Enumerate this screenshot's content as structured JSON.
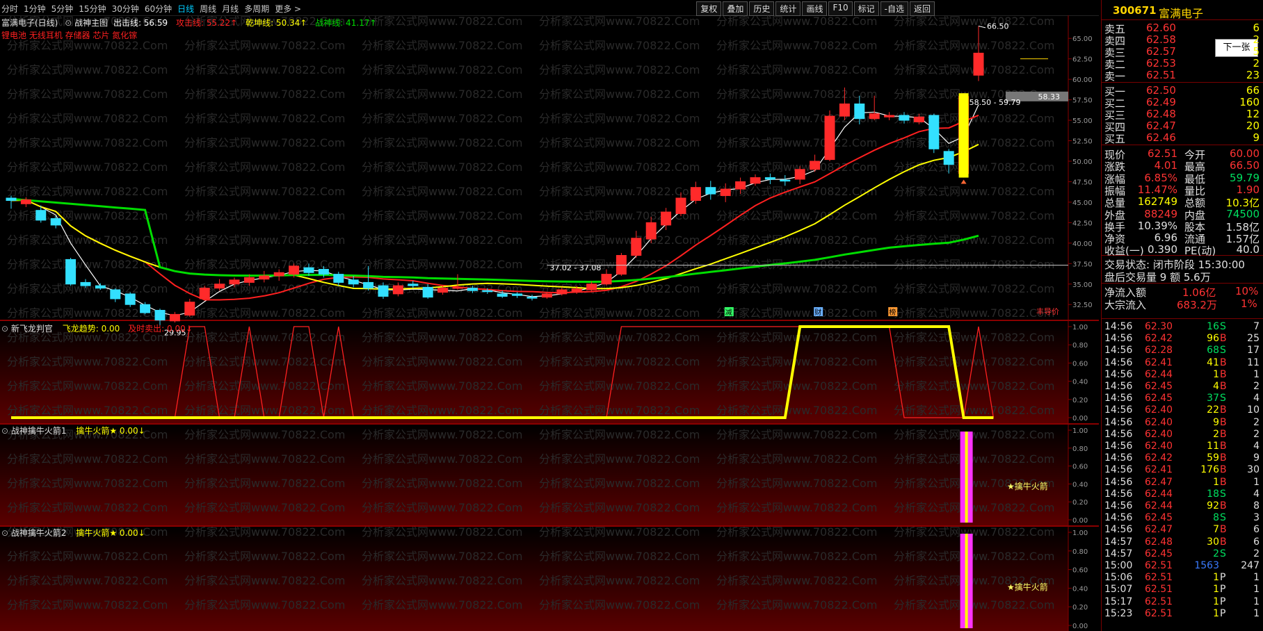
{
  "periods": [
    "分时",
    "1分钟",
    "5分钟",
    "15分钟",
    "30分钟",
    "60分钟",
    "日线",
    "周线",
    "月线",
    "多周期",
    "更多 >"
  ],
  "active_period": "日线",
  "toolbar": [
    "复权",
    "叠加",
    "历史",
    "统计",
    "画线",
    "F10",
    "标记",
    "-自选",
    "返回"
  ],
  "main_legend": {
    "stock": "富满电子(日线)",
    "indicator": "战神主图",
    "out_line": "出击线: 56.59",
    "attack_line": "攻击线: 55.22↑",
    "qian_line": "乾坤线: 50.34↑",
    "zhan_line": "战神线: 41.17↑"
  },
  "concepts": "锂电池 无线耳机 存储器 芯片 氮化镓",
  "price_labels": {
    "high": "66.50",
    "low": "29.95",
    "range1": "58.50 - 59.79",
    "range2": "37.02 - 37.08",
    "current": "58.33"
  },
  "markers": {
    "m1": "减",
    "m2": "财",
    "m3": "榜",
    "m4": "丰导价"
  },
  "y_axis_main": [
    "65.00",
    "62.50",
    "60.00",
    "57.50",
    "55.00",
    "52.50",
    "50.00",
    "47.50",
    "45.00",
    "42.50",
    "40.00",
    "37.50",
    "35.00",
    "32.50"
  ],
  "y_axis_ind": [
    "1.00",
    "0.80",
    "0.60",
    "0.40",
    "0.20",
    "0.00"
  ],
  "panel2": {
    "title": "新飞龙判官",
    "l1": "飞龙趋势: 0.00",
    "l2": "及时卖出: 0.00↓"
  },
  "panel3": {
    "title": "战神擒牛火箭1",
    "l1": "擒牛火箭★ 0.00↓",
    "flag": "★擒牛火箭"
  },
  "panel4": {
    "title": "战神擒牛火箭2",
    "l1": "擒牛火箭★ 0.00↓",
    "flag": "★擒牛火箭"
  },
  "watermark": "分析家公式网www.70822.Com",
  "chart_data": {
    "type": "candlestick",
    "candles": [
      [
        45.5,
        45.2,
        45.8,
        44.2
      ],
      [
        44.8,
        45.3,
        45.6,
        44.4
      ],
      [
        44.0,
        42.8,
        44.6,
        42.5
      ],
      [
        43.0,
        42.2,
        43.3,
        41.8
      ],
      [
        38.0,
        35.0,
        38.2,
        34.8
      ],
      [
        35.2,
        34.8,
        35.6,
        34.5
      ],
      [
        34.8,
        34.5,
        35.1,
        34.3
      ],
      [
        34.3,
        33.2,
        34.5,
        32.8
      ],
      [
        33.8,
        32.5,
        34.0,
        32.2
      ],
      [
        32.5,
        31.5,
        32.8,
        31.3
      ],
      [
        31.8,
        30.6,
        32.0,
        29.95
      ],
      [
        30.5,
        31.3,
        31.6,
        30.3
      ],
      [
        31.2,
        32.8,
        33.2,
        31.0
      ],
      [
        33.2,
        34.5,
        34.8,
        33.0
      ],
      [
        34.5,
        35.0,
        35.6,
        34.2
      ],
      [
        35.0,
        35.5,
        35.8,
        34.6
      ],
      [
        35.2,
        35.8,
        36.2,
        34.8
      ],
      [
        35.6,
        36.0,
        36.6,
        35.2
      ],
      [
        36.0,
        36.4,
        36.8,
        35.4
      ],
      [
        36.2,
        37.2,
        37.5,
        35.8
      ],
      [
        37.0,
        36.4,
        37.5,
        36.0
      ],
      [
        36.8,
        36.2,
        37.2,
        35.8
      ],
      [
        36.2,
        35.2,
        36.5,
        34.8
      ],
      [
        35.5,
        35.0,
        36.0,
        34.6
      ],
      [
        35.2,
        34.5,
        37.2,
        34.2
      ],
      [
        34.8,
        33.5,
        35.2,
        33.2
      ],
      [
        33.8,
        34.8,
        35.2,
        33.5
      ],
      [
        35.0,
        34.8,
        35.4,
        34.5
      ],
      [
        34.6,
        33.4,
        35.0,
        33.2
      ],
      [
        34.0,
        34.5,
        34.8,
        33.7
      ],
      [
        34.5,
        34.6,
        36.2,
        34.3
      ],
      [
        34.5,
        34.2,
        34.8,
        33.9
      ],
      [
        34.2,
        34.1,
        34.5,
        33.8
      ],
      [
        33.8,
        33.5,
        34.2,
        33.3
      ],
      [
        33.8,
        33.6,
        34.0,
        33.3
      ],
      [
        33.4,
        33.3,
        33.7,
        33.0
      ],
      [
        33.4,
        33.8,
        34.0,
        33.2
      ],
      [
        33.8,
        34.3,
        34.6,
        33.6
      ],
      [
        34.0,
        34.4,
        34.8,
        33.8
      ],
      [
        34.3,
        35.0,
        35.3,
        34.0
      ],
      [
        35.0,
        36.2,
        36.8,
        34.8
      ],
      [
        36.2,
        38.5,
        38.8,
        36.0
      ],
      [
        38.5,
        40.6,
        41.5,
        38.2
      ],
      [
        40.5,
        42.5,
        43.2,
        40.0
      ],
      [
        42.2,
        43.8,
        44.3,
        41.6
      ],
      [
        43.6,
        45.5,
        46.2,
        43.3
      ],
      [
        45.2,
        46.8,
        47.5,
        44.8
      ],
      [
        46.8,
        46.0,
        47.6,
        45.3
      ],
      [
        45.8,
        46.6,
        47.3,
        45.0
      ],
      [
        46.6,
        47.5,
        48.0,
        46.0
      ],
      [
        47.3,
        48.0,
        48.4,
        47.0
      ],
      [
        48.0,
        47.8,
        48.5,
        47.2
      ],
      [
        47.7,
        47.6,
        48.3,
        47.0
      ],
      [
        47.8,
        49.0,
        49.4,
        47.2
      ],
      [
        49.0,
        50.0,
        50.8,
        48.7
      ],
      [
        50.2,
        55.5,
        56.2,
        50.0
      ],
      [
        55.5,
        57.0,
        59.0,
        55.0
      ],
      [
        57.0,
        55.2,
        58.0,
        54.5
      ],
      [
        55.2,
        55.8,
        58.0,
        55.0
      ],
      [
        55.4,
        55.6,
        56.0,
        55.0
      ],
      [
        55.6,
        55.0,
        56.0,
        54.6
      ],
      [
        54.8,
        55.4,
        55.8,
        54.5
      ],
      [
        55.6,
        51.5,
        55.8,
        51.0
      ],
      [
        51.2,
        49.6,
        51.5,
        48.5
      ],
      [
        48.5,
        57.9,
        58.3,
        48.0
      ],
      [
        60.5,
        63.2,
        66.5,
        59.79
      ]
    ],
    "ma_series": [
      {
        "name": "出击线",
        "last": 56.59,
        "color": "#ffffff"
      },
      {
        "name": "攻击线",
        "last": 55.22,
        "color": "#ff2020"
      },
      {
        "name": "乾坤线",
        "last": 50.34,
        "color": "#ffff00"
      },
      {
        "name": "战神线",
        "last": 41.17,
        "color": "#00dd00"
      }
    ],
    "ylim": [
      31.5,
      66.8
    ],
    "indicator_feilong_qushi": [
      0,
      0,
      0,
      0,
      0,
      0,
      0,
      0,
      0,
      0,
      0,
      0,
      0,
      0,
      0,
      0,
      0,
      0,
      0,
      0,
      0,
      0,
      0,
      0,
      0,
      0,
      0,
      0,
      0,
      0,
      0,
      0,
      0,
      0,
      0,
      0,
      0,
      0,
      0,
      0,
      0,
      0,
      0,
      0,
      0,
      0,
      0,
      0,
      0,
      0,
      0,
      0,
      0,
      1,
      1,
      1,
      1,
      1,
      1,
      1,
      1,
      1,
      1,
      1,
      0,
      0,
      0
    ],
    "indicator_jishi_maichu": [
      0,
      0,
      0,
      0,
      0,
      0,
      0,
      0,
      0,
      0,
      0,
      0,
      1,
      1,
      0,
      0,
      1,
      0,
      0,
      1,
      1,
      0,
      1,
      0,
      0,
      0,
      0,
      0,
      0,
      0,
      0,
      0,
      0,
      0,
      0,
      0,
      0,
      0,
      0,
      0,
      0,
      1,
      1,
      1,
      1,
      1,
      1,
      1,
      1,
      1,
      1,
      1,
      1,
      1,
      1,
      1,
      1,
      1,
      1,
      1,
      0,
      0,
      0,
      0,
      0,
      1,
      0
    ]
  },
  "quote": {
    "code": "300671",
    "name": "富满电子",
    "button": "下一张",
    "asks": [
      [
        "卖五",
        "62.60",
        "6"
      ],
      [
        "卖四",
        "62.58",
        "2"
      ],
      [
        "卖三",
        "62.57",
        "5"
      ],
      [
        "卖二",
        "62.53",
        "2"
      ],
      [
        "卖一",
        "62.51",
        "23"
      ]
    ],
    "bids": [
      [
        "买一",
        "62.50",
        "66"
      ],
      [
        "买二",
        "62.49",
        "160"
      ],
      [
        "买三",
        "62.48",
        "12"
      ],
      [
        "买四",
        "62.47",
        "20"
      ],
      [
        "买五",
        "62.46",
        "9"
      ]
    ],
    "stats": [
      [
        "现价",
        "62.51",
        "今开",
        "60.00"
      ],
      [
        "涨跌",
        "4.01",
        "最高",
        "66.50"
      ],
      [
        "涨幅",
        "6.85%",
        "最低",
        "59.79"
      ],
      [
        "振幅",
        "11.47%",
        "量比",
        "1.90"
      ],
      [
        "总量",
        "162749",
        "总额",
        "10.3亿"
      ],
      [
        "外盘",
        "88249",
        "内盘",
        "74500"
      ],
      [
        "换手",
        "10.39%",
        "股本",
        "1.58亿"
      ],
      [
        "净资",
        "6.96",
        "流通",
        "1.57亿"
      ],
      [
        "收益(一)",
        "0.390",
        "PE(动)",
        "40.0"
      ]
    ],
    "trade_status": "交易状态: 闭市阶段 15:30:00",
    "after_hours": "盘后交易量 9 额 5.6万",
    "net_inflow": [
      "净流入额",
      "1.06亿",
      "10%"
    ],
    "big_inflow": [
      "大宗流入",
      "683.2万",
      "1%"
    ],
    "ticks": [
      [
        "14:56",
        "62.30",
        "16",
        "S",
        "7"
      ],
      [
        "14:56",
        "62.42",
        "96",
        "B",
        "25"
      ],
      [
        "14:56",
        "62.28",
        "68",
        "S",
        "17"
      ],
      [
        "14:56",
        "62.41",
        "41",
        "B",
        "11"
      ],
      [
        "14:56",
        "62.44",
        "1",
        "B",
        "1"
      ],
      [
        "14:56",
        "62.45",
        "4",
        "B",
        "2"
      ],
      [
        "14:56",
        "62.45",
        "37",
        "S",
        "4"
      ],
      [
        "14:56",
        "62.40",
        "22",
        "B",
        "10"
      ],
      [
        "14:56",
        "62.40",
        "9",
        "B",
        "2"
      ],
      [
        "14:56",
        "62.40",
        "2",
        "B",
        "2"
      ],
      [
        "14:56",
        "62.40",
        "11",
        "B",
        "4"
      ],
      [
        "14:56",
        "62.42",
        "59",
        "B",
        "9"
      ],
      [
        "14:56",
        "62.41",
        "176",
        "B",
        "30"
      ],
      [
        "14:56",
        "62.47",
        "1",
        "B",
        "1"
      ],
      [
        "14:56",
        "62.44",
        "18",
        "S",
        "4"
      ],
      [
        "14:56",
        "62.44",
        "92",
        "B",
        "8"
      ],
      [
        "14:56",
        "62.45",
        "8",
        "S",
        "3"
      ],
      [
        "14:56",
        "62.47",
        "7",
        "B",
        "6"
      ],
      [
        "14:57",
        "62.48",
        "30",
        "B",
        "6"
      ],
      [
        "14:57",
        "62.45",
        "2",
        "S",
        "2"
      ],
      [
        "15:00",
        "62.51",
        "1563",
        "",
        "247"
      ],
      [
        "15:06",
        "62.51",
        "1",
        "P",
        "1"
      ],
      [
        "15:07",
        "62.51",
        "1",
        "P",
        "1"
      ],
      [
        "15:17",
        "62.51",
        "1",
        "P",
        "1"
      ],
      [
        "15:23",
        "62.51",
        "1",
        "P",
        "1"
      ]
    ]
  }
}
